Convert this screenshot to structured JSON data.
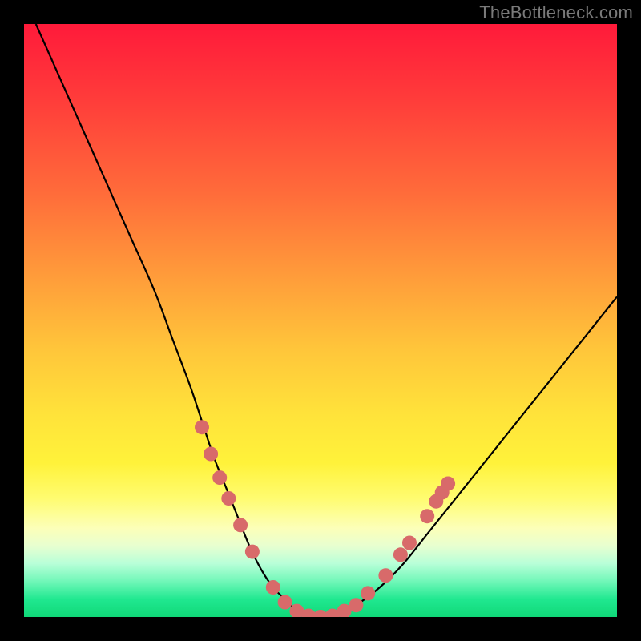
{
  "watermark": "TheBottleneck.com",
  "colors": {
    "background_outer": "#000000",
    "marker_fill": "#d86a6a",
    "curve_stroke": "#000000"
  },
  "chart_data": {
    "type": "line",
    "title": "",
    "xlabel": "",
    "ylabel": "",
    "xlim": [
      0,
      100
    ],
    "ylim": [
      0,
      100
    ],
    "grid": false,
    "series": [
      {
        "name": "bottleneck-curve",
        "x": [
          2,
          6,
          10,
          14,
          18,
          22,
          25,
          28,
          30,
          32,
          34,
          36,
          38,
          40,
          42,
          44,
          46,
          48,
          50,
          52,
          54,
          56,
          60,
          64,
          68,
          72,
          76,
          80,
          84,
          88,
          92,
          96,
          100
        ],
        "y": [
          100,
          91,
          82,
          73,
          64,
          55,
          47,
          39,
          33,
          27,
          22,
          17,
          12,
          8,
          5,
          3,
          1,
          0,
          0,
          0,
          1,
          2,
          5,
          9,
          14,
          19,
          24,
          29,
          34,
          39,
          44,
          49,
          54
        ]
      }
    ],
    "markers": [
      {
        "x": 30.0,
        "y": 32.0
      },
      {
        "x": 31.5,
        "y": 27.5
      },
      {
        "x": 33.0,
        "y": 23.5
      },
      {
        "x": 34.5,
        "y": 20.0
      },
      {
        "x": 36.5,
        "y": 15.5
      },
      {
        "x": 38.5,
        "y": 11.0
      },
      {
        "x": 42.0,
        "y": 5.0
      },
      {
        "x": 44.0,
        "y": 2.5
      },
      {
        "x": 46.0,
        "y": 1.0
      },
      {
        "x": 48.0,
        "y": 0.2
      },
      {
        "x": 50.0,
        "y": 0.0
      },
      {
        "x": 52.0,
        "y": 0.2
      },
      {
        "x": 54.0,
        "y": 1.0
      },
      {
        "x": 56.0,
        "y": 2.0
      },
      {
        "x": 58.0,
        "y": 4.0
      },
      {
        "x": 61.0,
        "y": 7.0
      },
      {
        "x": 63.5,
        "y": 10.5
      },
      {
        "x": 65.0,
        "y": 12.5
      },
      {
        "x": 68.0,
        "y": 17.0
      },
      {
        "x": 69.5,
        "y": 19.5
      },
      {
        "x": 70.5,
        "y": 21.0
      },
      {
        "x": 71.5,
        "y": 22.5
      }
    ],
    "marker_radius_px": 9
  }
}
